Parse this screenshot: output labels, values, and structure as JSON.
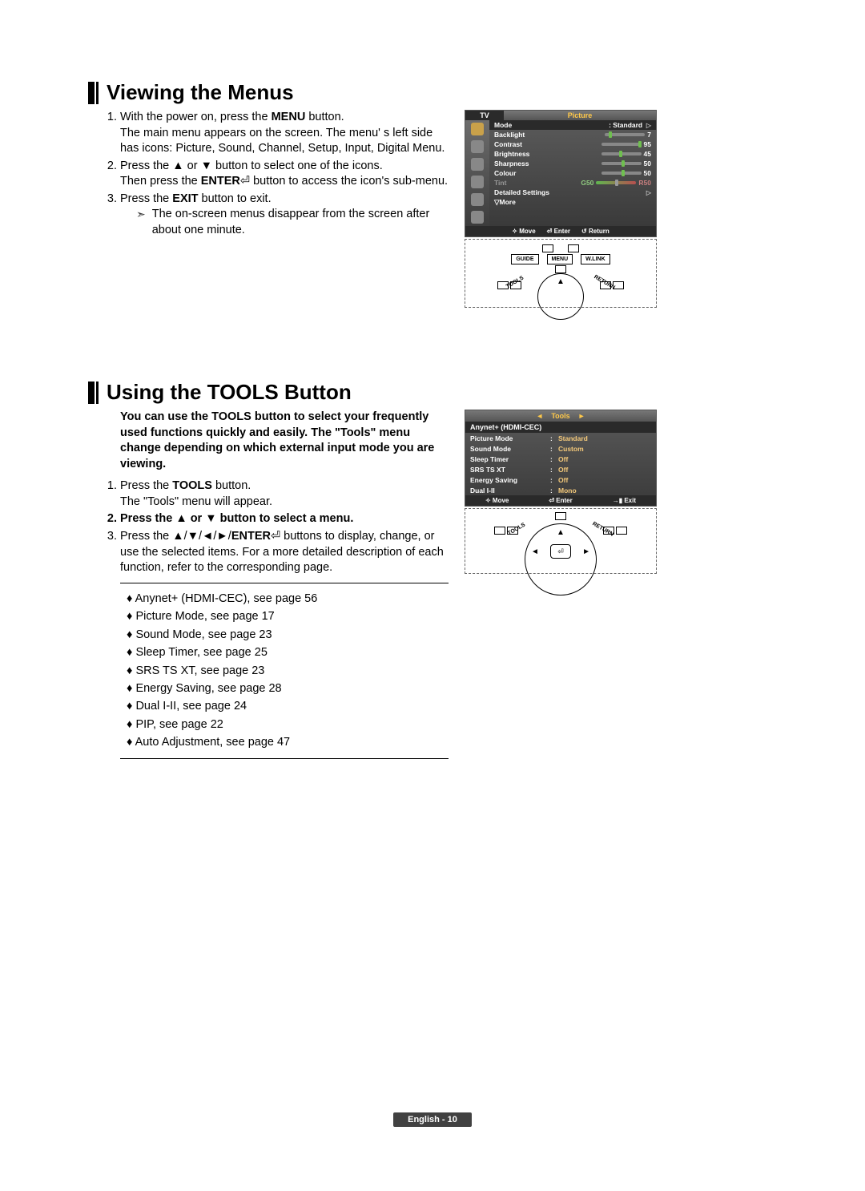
{
  "footer": "English - 10",
  "section1": {
    "heading": "Viewing the Menus",
    "steps": {
      "s1_a": "With the power on, press the ",
      "s1_b": "MENU",
      "s1_c": " button.",
      "s1_d": "The main menu appears on the screen. The menu' s left side has icons: Picture, Sound, Channel, Setup, Input, Digital Menu.",
      "s2_a": "Press the ▲ or ▼ button to select one of the icons.",
      "s2_b": "Then press the ",
      "s2_c": "ENTER",
      "s2_d": " button to access the icon's sub-menu.",
      "s3_a": "Press the ",
      "s3_b": "EXIT",
      "s3_c": " button to exit.",
      "s3_note": "The on-screen menus disappear from the screen after about one minute."
    },
    "osd": {
      "tv": "TV",
      "title": "Picture",
      "rows": [
        {
          "label": "Mode",
          "value": ": Standard",
          "selected": true,
          "arrow": "▷"
        },
        {
          "label": "Backlight",
          "slider": true,
          "value": "7",
          "thumb": 10
        },
        {
          "label": "Contrast",
          "slider": true,
          "value": "95",
          "thumb": 92
        },
        {
          "label": "Brightness",
          "slider": true,
          "value": "45",
          "thumb": 45
        },
        {
          "label": "Sharpness",
          "slider": true,
          "value": "50",
          "thumb": 50
        },
        {
          "label": "Colour",
          "slider": true,
          "value": "50",
          "thumb": 50
        },
        {
          "label": "Tint",
          "tint": true,
          "left": "G50",
          "right": "R50"
        },
        {
          "label": "Detailed Settings",
          "arrow": "▷"
        },
        {
          "label": "▽More"
        }
      ],
      "foot": {
        "move": "Move",
        "enter": "Enter",
        "return": "Return"
      }
    },
    "remote": {
      "guide": "GUIDE",
      "menu": "MENU",
      "wlink": "W.LINK",
      "tools": "TOOLS",
      "return": "RETURN"
    }
  },
  "section2": {
    "heading": "Using the TOOLS Button",
    "intro": "You can use the TOOLS button to select your frequently used functions quickly and easily. The \"Tools\" menu change depending on which external input mode you are viewing.",
    "steps": {
      "s1_a": "Press the ",
      "s1_b": "TOOLS",
      "s1_c": " button.",
      "s1_d": "The \"Tools\" menu will appear.",
      "s2": "Press the ▲ or ▼ button to select a menu.",
      "s3_a": "Press the ▲/▼/◄/►/",
      "s3_b": "ENTER",
      "s3_c": " buttons to display, change, or use the selected items. For a more detailed description of each function, refer to the corresponding page."
    },
    "bullets": [
      "Anynet+ (HDMI-CEC), see page 56",
      "Picture Mode, see page 17",
      "Sound Mode, see page 23",
      "Sleep Timer, see page 25",
      "SRS TS XT, see page 23",
      "Energy Saving, see page 28",
      "Dual I-II, see page 24",
      "PIP, see page 22",
      "Auto Adjustment, see page 47"
    ],
    "osd": {
      "title": "Tools",
      "highlight": "Anynet+ (HDMI-CEC)",
      "rows": [
        {
          "label": "Picture Mode",
          "value": "Standard"
        },
        {
          "label": "Sound Mode",
          "value": "Custom"
        },
        {
          "label": "Sleep Timer",
          "value": "Off"
        },
        {
          "label": "SRS TS XT",
          "value": "Off"
        },
        {
          "label": "Energy Saving",
          "value": "Off"
        },
        {
          "label": "Dual I-II",
          "value": "Mono"
        }
      ],
      "foot": {
        "move": "Move",
        "enter": "Enter",
        "exit": "Exit"
      }
    },
    "remote": {
      "tools": "TOOLS",
      "return": "RETURN"
    }
  }
}
